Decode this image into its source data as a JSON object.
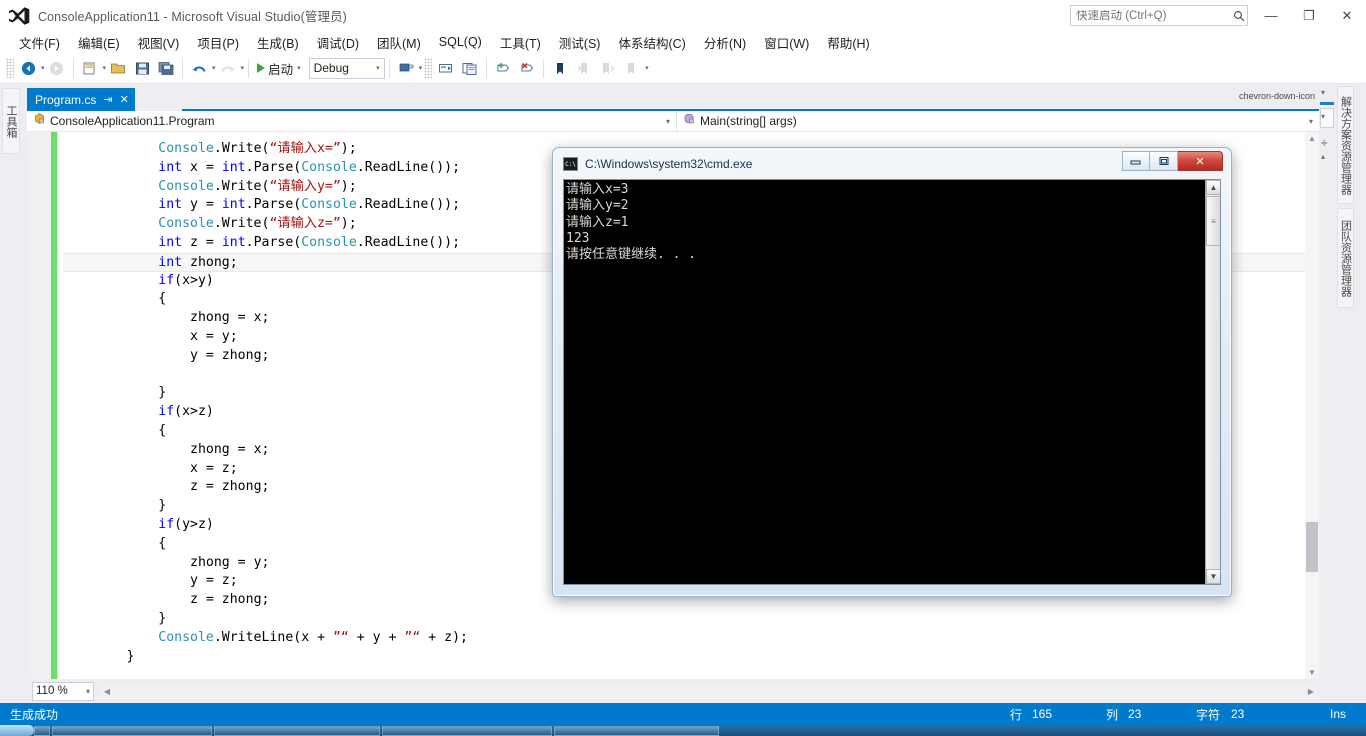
{
  "window": {
    "title": "ConsoleApplication11 - Microsoft Visual Studio(管理员)",
    "logo_icon": "visual-studio-logo-icon",
    "minimize_label": "—",
    "maximize_label": "❐",
    "close_label": "✕"
  },
  "quick_launch": {
    "placeholder": "快速启动 (Ctrl+Q)",
    "value": "",
    "icon": "search-icon"
  },
  "menu": {
    "items": [
      {
        "label": "文件(F)"
      },
      {
        "label": "编辑(E)"
      },
      {
        "label": "视图(V)"
      },
      {
        "label": "项目(P)"
      },
      {
        "label": "生成(B)"
      },
      {
        "label": "调试(D)"
      },
      {
        "label": "团队(M)"
      },
      {
        "label": "SQL(Q)"
      },
      {
        "label": "工具(T)"
      },
      {
        "label": "测试(S)"
      },
      {
        "label": "体系结构(C)"
      },
      {
        "label": "分析(N)"
      },
      {
        "label": "窗口(W)"
      },
      {
        "label": "帮助(H)"
      }
    ]
  },
  "toolbar": {
    "start_label": "启动",
    "config_value": "Debug",
    "buttons": [
      {
        "name": "navigate-backward-icon",
        "glyph": "◀"
      },
      {
        "name": "navigate-forward-icon",
        "glyph": "▶"
      },
      {
        "name": "new-project-icon",
        "glyph": "▤"
      },
      {
        "name": "open-file-icon",
        "glyph": "▤"
      },
      {
        "name": "save-icon",
        "glyph": "▤"
      },
      {
        "name": "save-all-icon",
        "glyph": "▤"
      },
      {
        "name": "undo-icon",
        "glyph": "↶"
      },
      {
        "name": "redo-icon",
        "glyph": "↷"
      },
      {
        "name": "start-debug-icon",
        "glyph": "▶"
      },
      {
        "name": "attach-to-process-icon",
        "glyph": "▤"
      },
      {
        "name": "comment-selection-icon",
        "glyph": "▤"
      },
      {
        "name": "uncomment-selection-icon",
        "glyph": "▤"
      },
      {
        "name": "add-bookmark-icon",
        "glyph": "▮"
      },
      {
        "name": "toggle-breakpoint-icon",
        "glyph": "●"
      },
      {
        "name": "delete-all-breakpoints-icon",
        "glyph": "✖"
      },
      {
        "name": "next-bookmark-icon",
        "glyph": "⇥"
      },
      {
        "name": "previous-bookmark-icon",
        "glyph": "⇤"
      },
      {
        "name": "clear-bookmarks-icon",
        "glyph": "⇥"
      }
    ]
  },
  "left_dock": {
    "toolbox_label": "工具箱"
  },
  "right_dock": {
    "tabs": [
      {
        "label": "解决方案资源管理器"
      },
      {
        "label": "团队资源管理器"
      }
    ]
  },
  "editor_tabs": {
    "active": {
      "label": "Program.cs",
      "pin_icon": "pin-icon",
      "close_icon": "close-icon"
    },
    "overflow_icon": "chevron-down-icon"
  },
  "navbar": {
    "class_value": "ConsoleApplication11.Program",
    "class_icon": "class-icon",
    "member_value": "Main(string[] args)",
    "member_icon": "method-icon"
  },
  "code": {
    "lines": [
      {
        "indent": 12,
        "current": false,
        "tokens": [
          {
            "t": "typ",
            "s": "Console"
          },
          {
            "t": "pl",
            "s": "."
          },
          {
            "t": "pl",
            "s": "Write"
          },
          {
            "t": "pl",
            "s": "("
          },
          {
            "t": "str",
            "s": "“请输入x=”"
          },
          {
            "t": "pl",
            "s": ");"
          }
        ]
      },
      {
        "indent": 12,
        "current": false,
        "tokens": [
          {
            "t": "kw",
            "s": "int"
          },
          {
            "t": "pl",
            "s": " x = "
          },
          {
            "t": "kw",
            "s": "int"
          },
          {
            "t": "pl",
            "s": ".Parse("
          },
          {
            "t": "typ",
            "s": "Console"
          },
          {
            "t": "pl",
            "s": ".ReadLine());"
          }
        ]
      },
      {
        "indent": 12,
        "current": false,
        "tokens": [
          {
            "t": "typ",
            "s": "Console"
          },
          {
            "t": "pl",
            "s": ".Write("
          },
          {
            "t": "str",
            "s": "“请输入y=”"
          },
          {
            "t": "pl",
            "s": ");"
          }
        ]
      },
      {
        "indent": 12,
        "current": false,
        "tokens": [
          {
            "t": "kw",
            "s": "int"
          },
          {
            "t": "pl",
            "s": " y = "
          },
          {
            "t": "kw",
            "s": "int"
          },
          {
            "t": "pl",
            "s": ".Parse("
          },
          {
            "t": "typ",
            "s": "Console"
          },
          {
            "t": "pl",
            "s": ".ReadLine());"
          }
        ]
      },
      {
        "indent": 12,
        "current": false,
        "tokens": [
          {
            "t": "typ",
            "s": "Console"
          },
          {
            "t": "pl",
            "s": ".Write("
          },
          {
            "t": "str",
            "s": "“请输入z=”"
          },
          {
            "t": "pl",
            "s": ");"
          }
        ]
      },
      {
        "indent": 12,
        "current": false,
        "tokens": [
          {
            "t": "kw",
            "s": "int"
          },
          {
            "t": "pl",
            "s": " z = "
          },
          {
            "t": "kw",
            "s": "int"
          },
          {
            "t": "pl",
            "s": ".Parse("
          },
          {
            "t": "typ",
            "s": "Console"
          },
          {
            "t": "pl",
            "s": ".ReadLine());"
          }
        ]
      },
      {
        "indent": 12,
        "current": true,
        "tokens": [
          {
            "t": "kw",
            "s": "int"
          },
          {
            "t": "pl",
            "s": " zhong;"
          }
        ]
      },
      {
        "indent": 12,
        "current": false,
        "tokens": [
          {
            "t": "kw",
            "s": "if"
          },
          {
            "t": "pl",
            "s": "(x>y)"
          }
        ]
      },
      {
        "indent": 12,
        "current": false,
        "tokens": [
          {
            "t": "pl",
            "s": "{"
          }
        ]
      },
      {
        "indent": 16,
        "current": false,
        "tokens": [
          {
            "t": "pl",
            "s": "zhong = x;"
          }
        ]
      },
      {
        "indent": 16,
        "current": false,
        "tokens": [
          {
            "t": "pl",
            "s": "x = y;"
          }
        ]
      },
      {
        "indent": 16,
        "current": false,
        "tokens": [
          {
            "t": "pl",
            "s": "y = zhong;"
          }
        ]
      },
      {
        "indent": 12,
        "current": false,
        "tokens": [
          {
            "t": "pl",
            "s": ""
          }
        ]
      },
      {
        "indent": 12,
        "current": false,
        "tokens": [
          {
            "t": "pl",
            "s": "}"
          }
        ]
      },
      {
        "indent": 12,
        "current": false,
        "tokens": [
          {
            "t": "kw",
            "s": "if"
          },
          {
            "t": "pl",
            "s": "(x>z)"
          }
        ]
      },
      {
        "indent": 12,
        "current": false,
        "tokens": [
          {
            "t": "pl",
            "s": "{"
          }
        ]
      },
      {
        "indent": 16,
        "current": false,
        "tokens": [
          {
            "t": "pl",
            "s": "zhong = x;"
          }
        ]
      },
      {
        "indent": 16,
        "current": false,
        "tokens": [
          {
            "t": "pl",
            "s": "x = z;"
          }
        ]
      },
      {
        "indent": 16,
        "current": false,
        "tokens": [
          {
            "t": "pl",
            "s": "z = zhong;"
          }
        ]
      },
      {
        "indent": 12,
        "current": false,
        "tokens": [
          {
            "t": "pl",
            "s": "}"
          }
        ]
      },
      {
        "indent": 12,
        "current": false,
        "tokens": [
          {
            "t": "kw",
            "s": "if"
          },
          {
            "t": "pl",
            "s": "(y>z)"
          }
        ]
      },
      {
        "indent": 12,
        "current": false,
        "tokens": [
          {
            "t": "pl",
            "s": "{"
          }
        ]
      },
      {
        "indent": 16,
        "current": false,
        "tokens": [
          {
            "t": "pl",
            "s": "zhong = y;"
          }
        ]
      },
      {
        "indent": 16,
        "current": false,
        "tokens": [
          {
            "t": "pl",
            "s": "y = z;"
          }
        ]
      },
      {
        "indent": 16,
        "current": false,
        "tokens": [
          {
            "t": "pl",
            "s": "z = zhong;"
          }
        ]
      },
      {
        "indent": 12,
        "current": false,
        "tokens": [
          {
            "t": "pl",
            "s": "}"
          }
        ]
      },
      {
        "indent": 12,
        "current": false,
        "tokens": [
          {
            "t": "typ",
            "s": "Console"
          },
          {
            "t": "pl",
            "s": ".WriteLine(x + "
          },
          {
            "t": "str",
            "s": "”“"
          },
          {
            "t": "pl",
            "s": " + y + "
          },
          {
            "t": "str",
            "s": "”“"
          },
          {
            "t": "pl",
            "s": " + z);"
          }
        ]
      },
      {
        "indent": 8,
        "current": false,
        "tokens": [
          {
            "t": "pl",
            "s": "}"
          }
        ]
      }
    ]
  },
  "console": {
    "title": "C:\\Windows\\system32\\cmd.exe",
    "icon": "cmd-icon",
    "icon_label": "C:\\",
    "minimize_label": "▬",
    "maximize_label": "❐",
    "close_label": "✕",
    "output": "请输入x=3\n请输入y=2\n请输入z=1\n123\n请按任意键继续. . ."
  },
  "zoombar": {
    "zoom_value": "110 %",
    "caret": "▾"
  },
  "statusbar": {
    "message": "生成成功",
    "line_label": "行",
    "line_value": "165",
    "col_label": "列",
    "col_value": "23",
    "char_label": "字符",
    "char_value": "23",
    "insert_mode": "Ins"
  },
  "colors": {
    "accent": "#007acc",
    "keyword": "#0000ff",
    "type": "#2b91af",
    "string": "#a31515",
    "change_bar": "#6fdc6f",
    "close_button": "#cf4b41"
  }
}
